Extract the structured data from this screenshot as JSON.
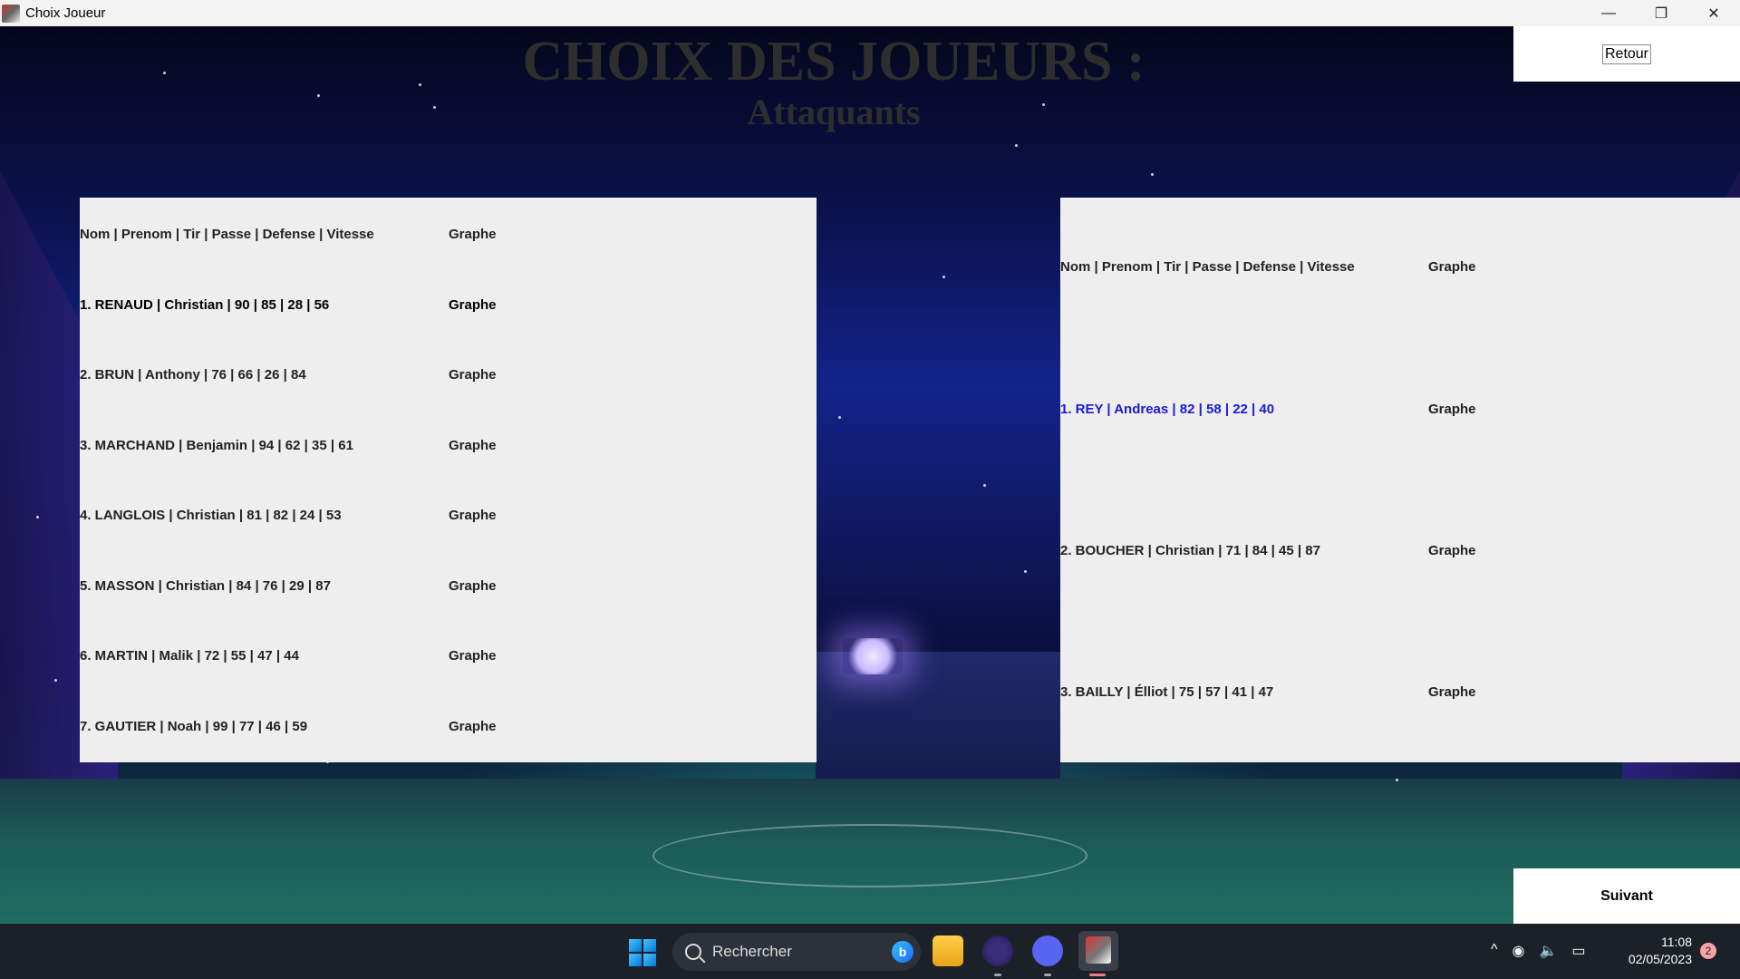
{
  "window": {
    "title": "Choix Joueur",
    "minimize_glyph": "—",
    "restore_glyph": "❐",
    "close_glyph": "✕"
  },
  "heading": {
    "main": "CHOIX DES JOUEURS :",
    "sub": "Attaquants"
  },
  "buttons": {
    "back": "Retour",
    "next": "Suivant"
  },
  "left_panel": {
    "header": "Nom | Prenom | Tir | Passe | Defense | Vitesse",
    "graph_header": "Graphe",
    "rows": [
      {
        "label": "1. RENAUD | Christian | 90 | 85 | 28 | 56",
        "graph": "Graphe"
      },
      {
        "label": "2. BRUN | Anthony | 76 | 66 | 26 | 84",
        "graph": "Graphe"
      },
      {
        "label": "3. MARCHAND | Benjamin | 94 | 62 | 35 | 61",
        "graph": "Graphe"
      },
      {
        "label": "4. LANGLOIS | Christian | 81 | 82 | 24 | 53",
        "graph": "Graphe"
      },
      {
        "label": "5. MASSON | Christian | 84 | 76 | 29 | 87",
        "graph": "Graphe"
      },
      {
        "label": "6. MARTIN | Malik | 72 | 55 | 47 | 44",
        "graph": "Graphe"
      },
      {
        "label": "7. GAUTIER | Noah | 99 | 77 | 46 | 59",
        "graph": "Graphe"
      }
    ]
  },
  "right_panel": {
    "header": "Nom | Prenom | Tir | Passe | Defense | Vitesse",
    "graph_header": "Graphe",
    "rows": [
      {
        "label": "1. REY  | Andreas | 82 | 58 | 22 | 40",
        "graph": "Graphe"
      },
      {
        "label": "2. BOUCHER | Christian | 71 | 84 | 45 | 87",
        "graph": "Graphe"
      },
      {
        "label": "3. BAILLY | Élliot | 75 | 57 | 41 | 47",
        "graph": "Graphe"
      }
    ]
  },
  "taskbar": {
    "search_placeholder": "Rechercher",
    "bing_glyph": "b",
    "tray_chevron": "^",
    "wifi_glyph": "◉",
    "volume_glyph": "🔈",
    "battery_glyph": "▭",
    "time": "11:08",
    "date": "02/05/2023",
    "notification_count": "2"
  },
  "colors": {
    "selected_row": "#1a1ad6",
    "panel_bg": "#eeeeee",
    "heading": "#2e2e2e"
  }
}
